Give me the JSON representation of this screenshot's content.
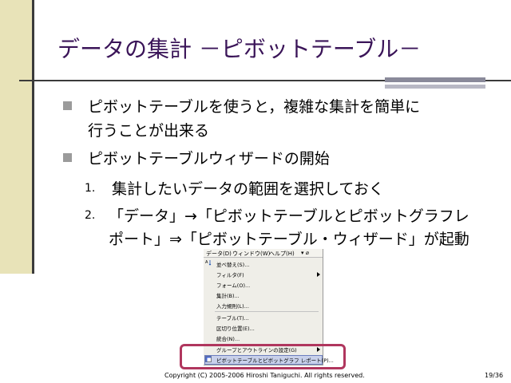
{
  "slide": {
    "title": "データの集計 －ピボットテーブル－",
    "bullets": [
      {
        "line1": "ピボットテーブルを使うと，複雑な集計を簡単に",
        "line2": "行うことが出来る"
      },
      {
        "line1": "ピボットテーブルウィザードの開始"
      }
    ],
    "steps": [
      {
        "num": "1.",
        "line1": "集計したいデータの範囲を選択しておく"
      },
      {
        "num": "2.",
        "line1": "「データ」→「ピボットテーブルとピボットグラフレ",
        "line2": "ポート」⇒「ピボットテーブル・ウィザード」が起動"
      }
    ],
    "footer": "Copyright (C) 2005-2006 Hiroshi Taniguchi. All rights reserved.",
    "page": "19/36"
  },
  "menu": {
    "menubar": [
      "データ(D)",
      "ウィンドウ(W)",
      "ヘルプ(H)",
      "▾ ⌀"
    ],
    "items": [
      {
        "label": "並べ替え(S)...",
        "icon": "sort-icon"
      },
      {
        "label": "フィルタ(F)",
        "submenu": true
      },
      {
        "label": "フォーム(O)..."
      },
      {
        "label": "集計(B)..."
      },
      {
        "label": "入力規則(L)..."
      },
      {
        "label": "テーブル(T)..."
      },
      {
        "label": "区切り位置(E)..."
      },
      {
        "label": "統合(N)..."
      },
      {
        "label": "グループとアウトラインの設定(G)",
        "submenu": true
      },
      {
        "label": "ピボットテーブルとピボットグラフ レポート(P)...",
        "icon": "pivot-icon",
        "highlighted": true
      }
    ]
  },
  "colors": {
    "title": "#3a1458",
    "left_bar": "#e8e3b8",
    "highlight_border": "#b0365e"
  }
}
